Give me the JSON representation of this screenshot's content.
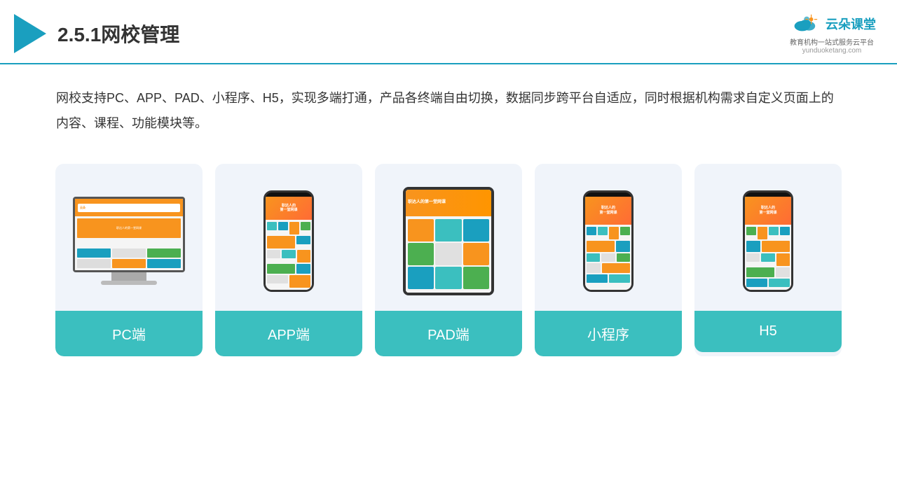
{
  "header": {
    "title": "2.5.1网校管理",
    "logo_name": "云朵课堂",
    "logo_url": "yunduoketang.com",
    "logo_tagline": "教育机构一站\n式服务云平台"
  },
  "description": {
    "text": "网校支持PC、APP、PAD、小程序、H5，实现多端打通，产品各终端自由切换，数据同步跨平台自适应，同时根据机构需求自定义页面上的内容、课程、功能模块等。"
  },
  "cards": [
    {
      "id": "pc",
      "label": "PC端"
    },
    {
      "id": "app",
      "label": "APP端"
    },
    {
      "id": "pad",
      "label": "PAD端"
    },
    {
      "id": "miniprogram",
      "label": "小程序"
    },
    {
      "id": "h5",
      "label": "H5"
    }
  ],
  "colors": {
    "teal": "#3bbfbf",
    "accent": "#1a9fbf",
    "orange": "#f8941e"
  }
}
